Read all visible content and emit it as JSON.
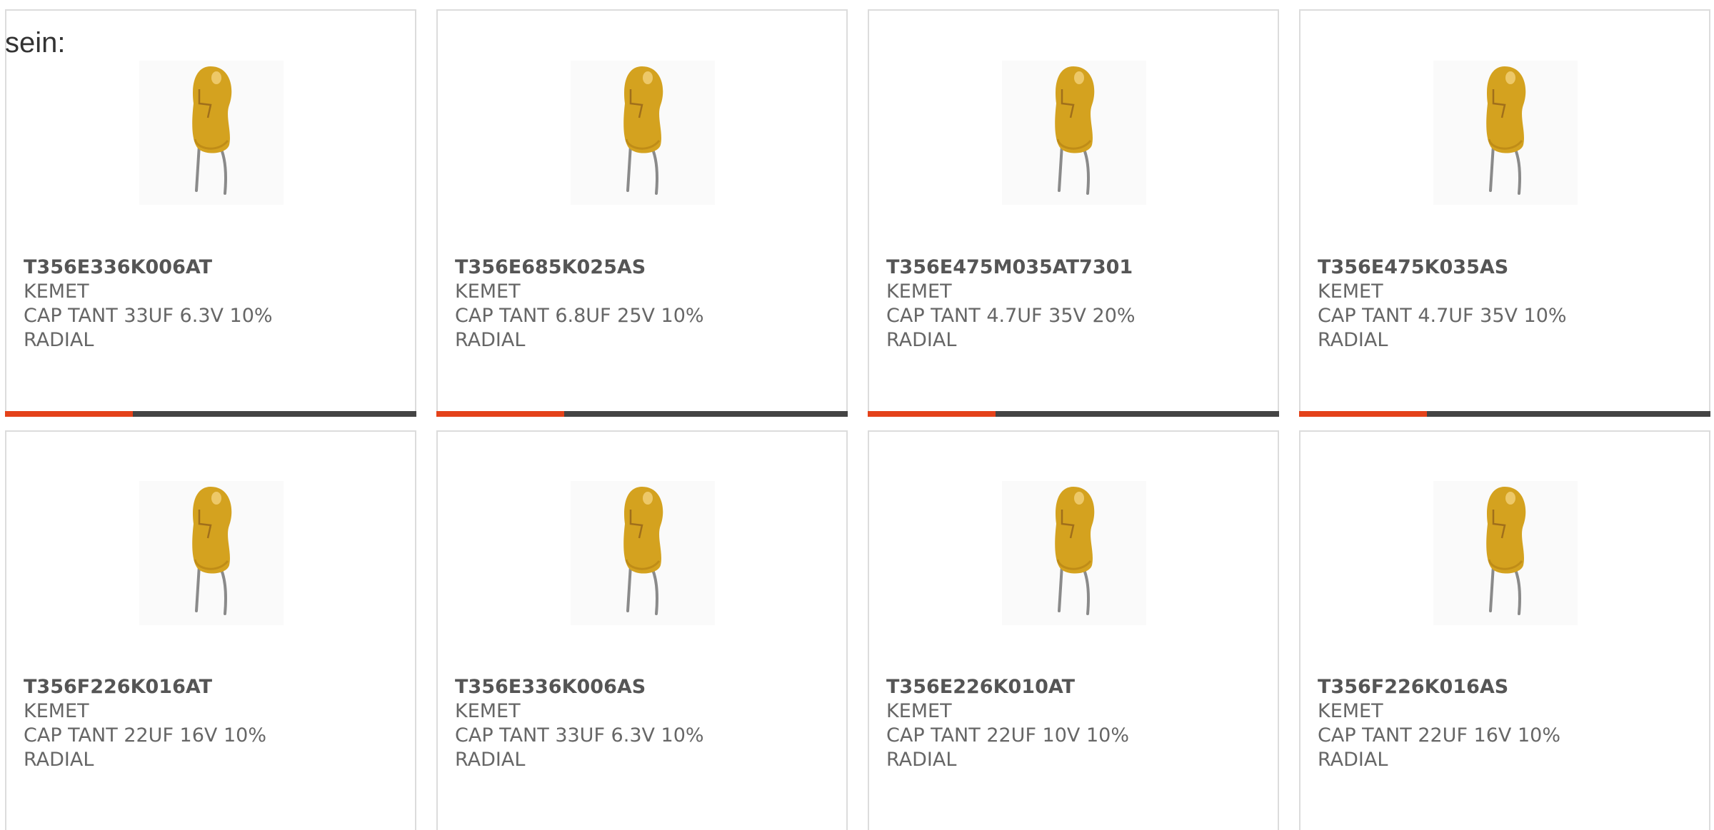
{
  "intro_text": "sein:",
  "colors": {
    "accent": "#e4421a",
    "bar_track": "#444444",
    "card_border": "#dcdcdc",
    "capacitor_body": "#d4a21f",
    "capacitor_leads": "#8a8a8a"
  },
  "products": [
    {
      "part_number": "T356E336K006AT",
      "manufacturer": "KEMET",
      "description": "CAP TANT 33UF 6.3V 10%",
      "mounting": "RADIAL",
      "image_icon": "tantalum-capacitor-icon",
      "progress": 0.31
    },
    {
      "part_number": "T356E685K025AS",
      "manufacturer": "KEMET",
      "description": "CAP TANT 6.8UF 25V 10%",
      "mounting": "RADIAL",
      "image_icon": "tantalum-capacitor-icon",
      "progress": 0.31
    },
    {
      "part_number": "T356E475M035AT7301",
      "manufacturer": "KEMET",
      "description": "CAP TANT 4.7UF 35V 20%",
      "mounting": "RADIAL",
      "image_icon": "tantalum-capacitor-icon",
      "progress": 0.31
    },
    {
      "part_number": "T356E475K035AS",
      "manufacturer": "KEMET",
      "description": "CAP TANT 4.7UF 35V 10%",
      "mounting": "RADIAL",
      "image_icon": "tantalum-capacitor-icon",
      "progress": 0.31
    },
    {
      "part_number": "T356F226K016AT",
      "manufacturer": "KEMET",
      "description": "CAP TANT 22UF 16V 10%",
      "mounting": "RADIAL",
      "image_icon": "tantalum-capacitor-icon"
    },
    {
      "part_number": "T356E336K006AS",
      "manufacturer": "KEMET",
      "description": "CAP TANT 33UF 6.3V 10%",
      "mounting": "RADIAL",
      "image_icon": "tantalum-capacitor-icon"
    },
    {
      "part_number": "T356E226K010AT",
      "manufacturer": "KEMET",
      "description": "CAP TANT 22UF 10V 10%",
      "mounting": "RADIAL",
      "image_icon": "tantalum-capacitor-icon"
    },
    {
      "part_number": "T356F226K016AS",
      "manufacturer": "KEMET",
      "description": "CAP TANT 22UF 16V 10%",
      "mounting": "RADIAL",
      "image_icon": "tantalum-capacitor-icon"
    }
  ]
}
